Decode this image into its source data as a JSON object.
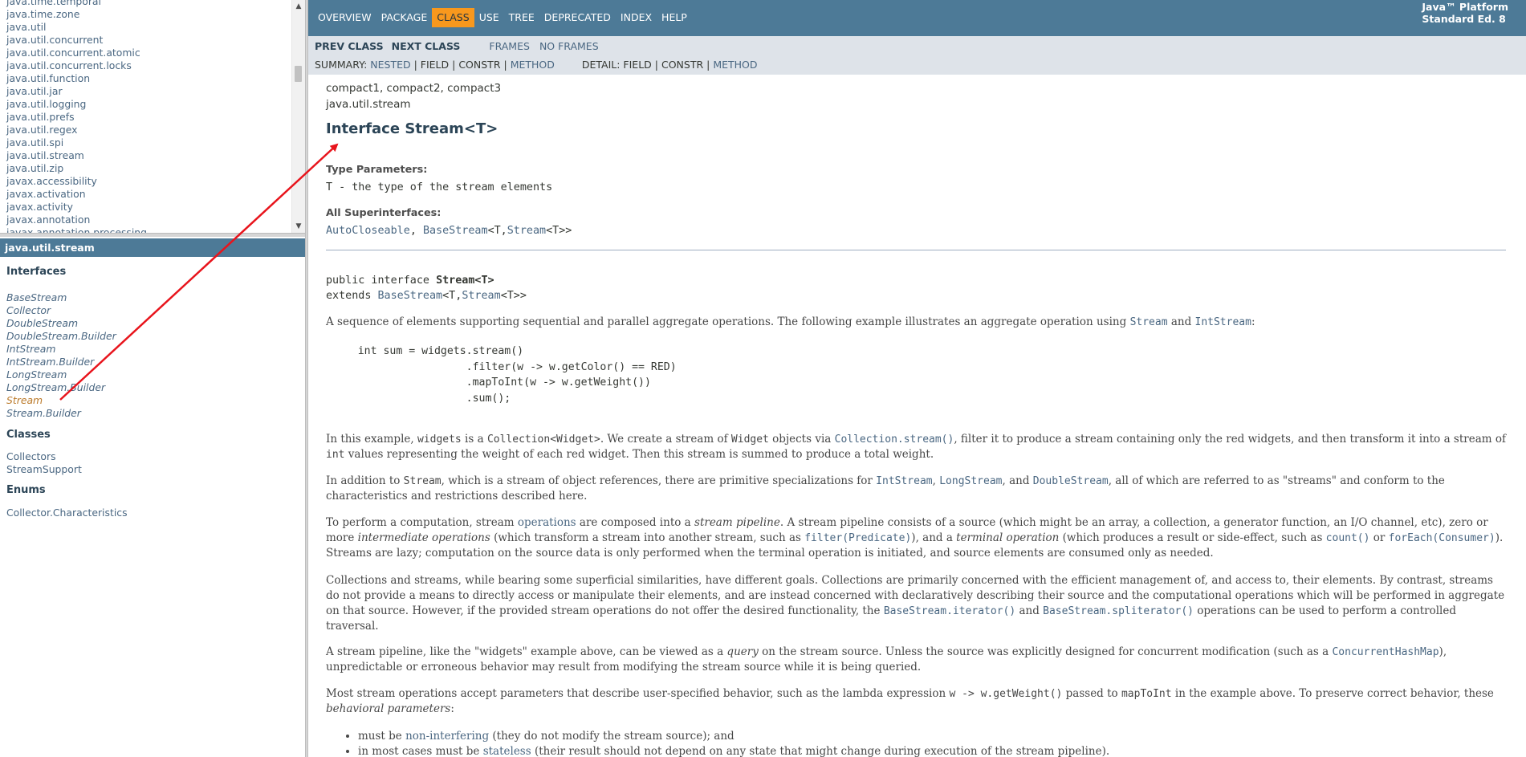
{
  "packages_frame": {
    "items": [
      "java.time.temporal",
      "java.time.zone",
      "java.util",
      "java.util.concurrent",
      "java.util.concurrent.atomic",
      "java.util.concurrent.locks",
      "java.util.function",
      "java.util.jar",
      "java.util.logging",
      "java.util.prefs",
      "java.util.regex",
      "java.util.spi",
      "java.util.stream",
      "java.util.zip",
      "javax.accessibility",
      "javax.activation",
      "javax.activity",
      "javax.annotation",
      "javax.annotation.processing"
    ]
  },
  "classes_frame": {
    "package_title": "java.util.stream",
    "interfaces_heading": "Interfaces",
    "interfaces": [
      "BaseStream",
      "Collector",
      "DoubleStream",
      "DoubleStream.Builder",
      "IntStream",
      "IntStream.Builder",
      "LongStream",
      "LongStream.Builder",
      "Stream",
      "Stream.Builder"
    ],
    "current": "Stream",
    "classes_heading": "Classes",
    "classes": [
      "Collectors",
      "StreamSupport"
    ],
    "enums_heading": "Enums",
    "enums": [
      "Collector.Characteristics"
    ]
  },
  "topnav": {
    "items": [
      "Overview",
      "Package",
      "Class",
      "Use",
      "Tree",
      "Deprecated",
      "Index",
      "Help"
    ],
    "active": "Class",
    "platform_line1": "Java™ Platform",
    "platform_line2": "Standard Ed. 8"
  },
  "subnav": {
    "prev_class": "Prev Class",
    "next_class": "Next Class",
    "frames": "Frames",
    "no_frames": "No Frames",
    "summary_prefix": "SUMMARY: ",
    "summary_nested": "NESTED",
    "summary_field": "FIELD",
    "summary_constr": "CONSTR",
    "summary_method": "METHOD",
    "detail_prefix": "DETAIL: ",
    "detail_field": "FIELD",
    "detail_constr": "CONSTR",
    "detail_method": "METHOD",
    "sep": " | "
  },
  "content": {
    "profiles": "compact1, compact2, compact3",
    "package": "java.util.stream",
    "title": "Interface Stream<T>",
    "type_params_label": "Type Parameters:",
    "type_param_name": "T",
    "type_param_desc": " - the type of the stream elements",
    "superinterfaces_label": "All Superinterfaces:",
    "super_autocloseable": "AutoCloseable",
    "super_comma": ", ",
    "super_basestream": "BaseStream",
    "super_basestream_args_1": "<T,",
    "super_stream": "Stream",
    "super_basestream_args_2": "<T>>",
    "decl_line1_prefix": "public interface ",
    "decl_line1_name": "Stream<T>",
    "decl_line2_prefix": "extends ",
    "decl_line2_link1": "BaseStream",
    "decl_line2_mid": "<T,",
    "decl_line2_link2": "Stream",
    "decl_line2_end": "<T>>",
    "p1_text": "A sequence of elements supporting sequential and parallel aggregate operations. The following example illustrates an aggregate operation using ",
    "p1_link1": "Stream",
    "p1_and": " and ",
    "p1_link2": "IntStream",
    "p1_end": ":",
    "code_example": "     int sum = widgets.stream()\n                      .filter(w -> w.getColor() == RED)\n                      .mapToInt(w -> w.getWeight())\n                      .sum();",
    "p2_a": "In this example, ",
    "p2_code1": "widgets",
    "p2_b": " is a ",
    "p2_code2": "Collection<Widget>",
    "p2_c": ". We create a stream of ",
    "p2_code3": "Widget",
    "p2_d": " objects via ",
    "p2_link": "Collection.stream()",
    "p2_e": ", filter it to produce a stream containing only the red widgets, and then transform it into a stream of ",
    "p2_code4": "int",
    "p2_f": " values representing the weight of each red widget. Then this stream is summed to produce a total weight.",
    "p3_a": "In addition to ",
    "p3_code1": "Stream",
    "p3_b": ", which is a stream of object references, there are primitive specializations for ",
    "p3_link1": "IntStream",
    "p3_c": ", ",
    "p3_link2": "LongStream",
    "p3_d": ", and ",
    "p3_link3": "DoubleStream",
    "p3_e": ", all of which are referred to as \"streams\" and conform to the characteristics and restrictions described here.",
    "p4_a": "To perform a computation, stream ",
    "p4_link1": "operations",
    "p4_b": " are composed into a ",
    "p4_em1": "stream pipeline",
    "p4_c": ". A stream pipeline consists of a source (which might be an array, a collection, a generator function, an I/O channel, etc), zero or more ",
    "p4_em2": "intermediate operations",
    "p4_d": " (which transform a stream into another stream, such as ",
    "p4_link2": "filter(Predicate)",
    "p4_e": "), and a ",
    "p4_em3": "terminal operation",
    "p4_f": " (which produces a result or side-effect, such as ",
    "p4_link3": "count()",
    "p4_g": " or ",
    "p4_link4": "forEach(Consumer)",
    "p4_h": "). Streams are lazy; computation on the source data is only performed when the terminal operation is initiated, and source elements are consumed only as needed.",
    "p5_a": "Collections and streams, while bearing some superficial similarities, have different goals. Collections are primarily concerned with the efficient management of, and access to, their elements. By contrast, streams do not provide a means to directly access or manipulate their elements, and are instead concerned with declaratively describing their source and the computational operations which will be performed in aggregate on that source. However, if the provided stream operations do not offer the desired functionality, the ",
    "p5_link1": "BaseStream.iterator()",
    "p5_b": " and ",
    "p5_link2": "BaseStream.spliterator()",
    "p5_c": " operations can be used to perform a controlled traversal.",
    "p6_a": "A stream pipeline, like the \"widgets\" example above, can be viewed as a ",
    "p6_em": "query",
    "p6_b": " on the stream source. Unless the source was explicitly designed for concurrent modification (such as a ",
    "p6_link": "ConcurrentHashMap",
    "p6_c": "), unpredictable or erroneous behavior may result from modifying the stream source while it is being queried.",
    "p7_a": "Most stream operations accept parameters that describe user-specified behavior, such as the lambda expression ",
    "p7_code1": "w -> w.getWeight()",
    "p7_b": " passed to ",
    "p7_code2": "mapToInt",
    "p7_c": " in the example above. To preserve correct behavior, these ",
    "p7_em": "behavioral parameters",
    "p7_d": ":",
    "li1_a": "must be ",
    "li1_link": "non-interfering",
    "li1_b": " (they do not modify the stream source); and",
    "li2_a": "in most cases must be ",
    "li2_link": "stateless",
    "li2_b": " (their result should not depend on any state that might change during execution of the stream pipeline)."
  },
  "colors": {
    "nav_blue": "#4d7a97",
    "active_orange": "#f8981d",
    "subnav_gray": "#dee3e9",
    "link": "#4a6782",
    "annotation_arrow": "#e8141c"
  }
}
